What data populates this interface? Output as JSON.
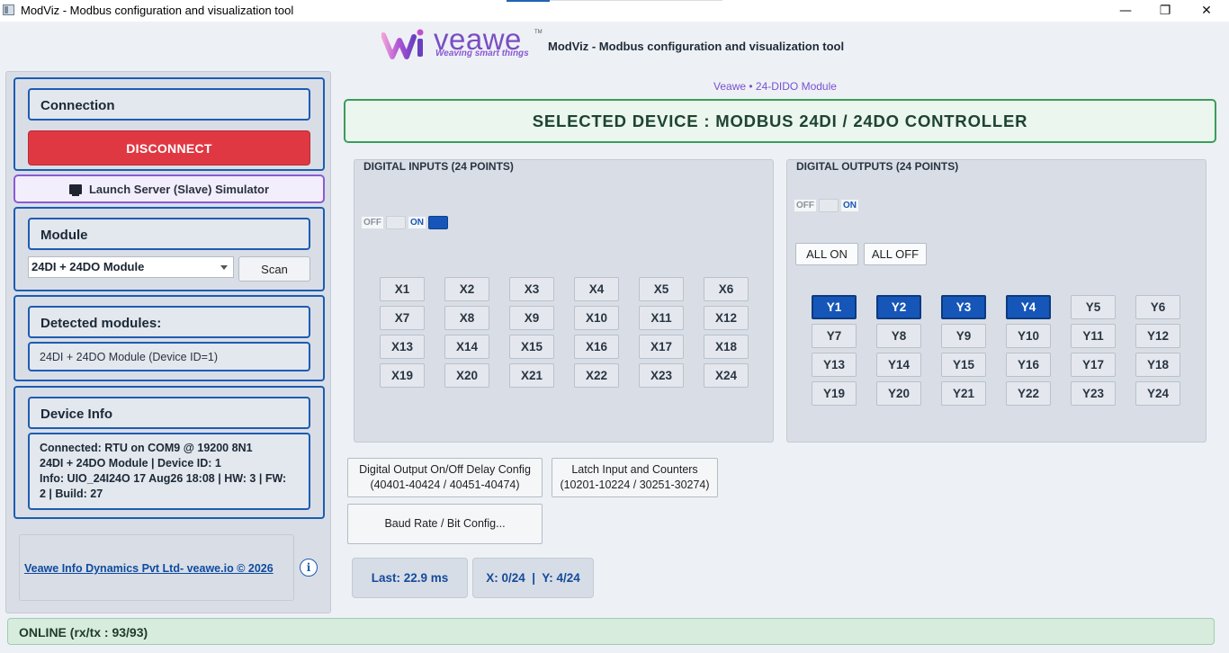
{
  "window": {
    "title": "ModViz - Modbus configuration and visualization tool",
    "minimize": "—",
    "restore": "❐",
    "close": "✕"
  },
  "header": {
    "logo_word": "veawe",
    "logo_tm": "TM",
    "logo_tagline": "Weaving smart things",
    "app_title": "ModViz - Modbus configuration and visualization tool",
    "subtitle": "Veawe • 24-DIDO Module"
  },
  "sidebar": {
    "connection_label": "Connection",
    "disconnect_label": "DISCONNECT",
    "simulator_label": "Launch Server (Slave) Simulator",
    "module_label": "Module",
    "module_selected": "24DI + 24DO Module",
    "scan_label": "Scan",
    "detected_label": "Detected modules:",
    "detected_value": "24DI + 24DO Module (Device ID=1)",
    "device_info_label": "Device Info",
    "device_info_lines": [
      "Connected: RTU on COM9 @ 19200 8N1",
      "24DI + 24DO Module | Device ID: 1",
      "Info: UIO_24I24O 17 Aug26 18:08 | HW: 3 | FW:",
      "2 | Build: 27"
    ],
    "footer_link": "Veawe Info Dynamics Pvt Ltd- veawe.io © 2026",
    "info_icon": "i"
  },
  "banner": {
    "text": "SELECTED DEVICE : MODBUS 24DI / 24DO CONTROLLER"
  },
  "inputs": {
    "title": "DIGITAL INPUTS (24 POINTS)",
    "toggle_off": "OFF",
    "toggle_on": "ON",
    "points": [
      "X1",
      "X2",
      "X3",
      "X4",
      "X5",
      "X6",
      "X7",
      "X8",
      "X9",
      "X10",
      "X11",
      "X12",
      "X13",
      "X14",
      "X15",
      "X16",
      "X17",
      "X18",
      "X19",
      "X20",
      "X21",
      "X22",
      "X23",
      "X24"
    ],
    "active": []
  },
  "outputs": {
    "title": "DIGITAL OUTPUTS (24 POINTS)",
    "toggle_off": "OFF",
    "toggle_on": "ON",
    "all_on": "ALL ON",
    "all_off": "ALL OFF",
    "points": [
      "Y1",
      "Y2",
      "Y3",
      "Y4",
      "Y5",
      "Y6",
      "Y7",
      "Y8",
      "Y9",
      "Y10",
      "Y11",
      "Y12",
      "Y13",
      "Y14",
      "Y15",
      "Y16",
      "Y17",
      "Y18",
      "Y19",
      "Y20",
      "Y21",
      "Y22",
      "Y23",
      "Y24"
    ],
    "active": [
      "Y1",
      "Y2",
      "Y3",
      "Y4"
    ]
  },
  "config": {
    "delay_title": "Digital Output On/Off Delay Config",
    "delay_sub": "(40401-40424 / 40451-40474)",
    "latch_title": "Latch Input and Counters",
    "latch_sub": "(10201-10224 / 30251-30274)",
    "baud_label": "Baud Rate / Bit Config..."
  },
  "stats": {
    "last": "Last: 22.9 ms",
    "counts": "X: 0/24  |  Y: 4/24"
  },
  "status": {
    "text": "ONLINE (rx/tx : 93/93)"
  },
  "colors": {
    "accent_blue": "#1656b8",
    "disconnect_red": "#e03842",
    "online_green": "#d7ecdd",
    "brand_purple": "#7b4ec2"
  }
}
